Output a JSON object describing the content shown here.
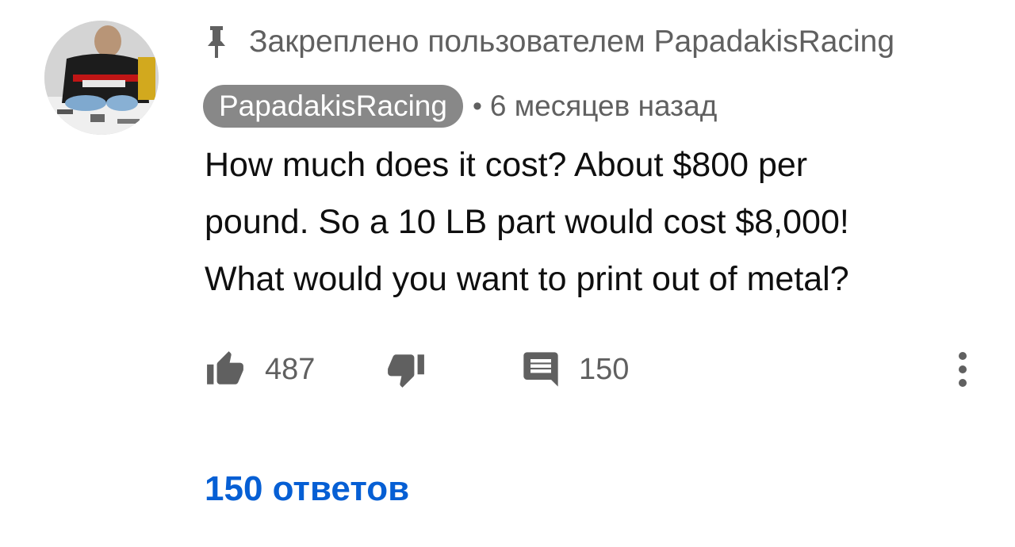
{
  "pinned": {
    "icon": "pin-icon",
    "text": "Закреплено пользователем PapadakisRacing"
  },
  "comment": {
    "author": "PapadakisRacing",
    "separator": "•",
    "time": "6 месяцев назад",
    "lines": [
      "How much does it cost? About $800 per",
      "pound. So a 10 LB part would cost $8,000!",
      "What would you want to print out of metal?"
    ],
    "likes": "487",
    "reply_count": "150",
    "replies_link": "150 ответов"
  },
  "colors": {
    "accent": "#065fd4",
    "secondary_text": "#606060",
    "author_chip": "#888888"
  },
  "icons": {
    "avatar": "avatar",
    "like": "thumbs-up-icon",
    "dislike": "thumbs-down-icon",
    "reply": "comment-icon",
    "more": "more-vertical-icon"
  }
}
